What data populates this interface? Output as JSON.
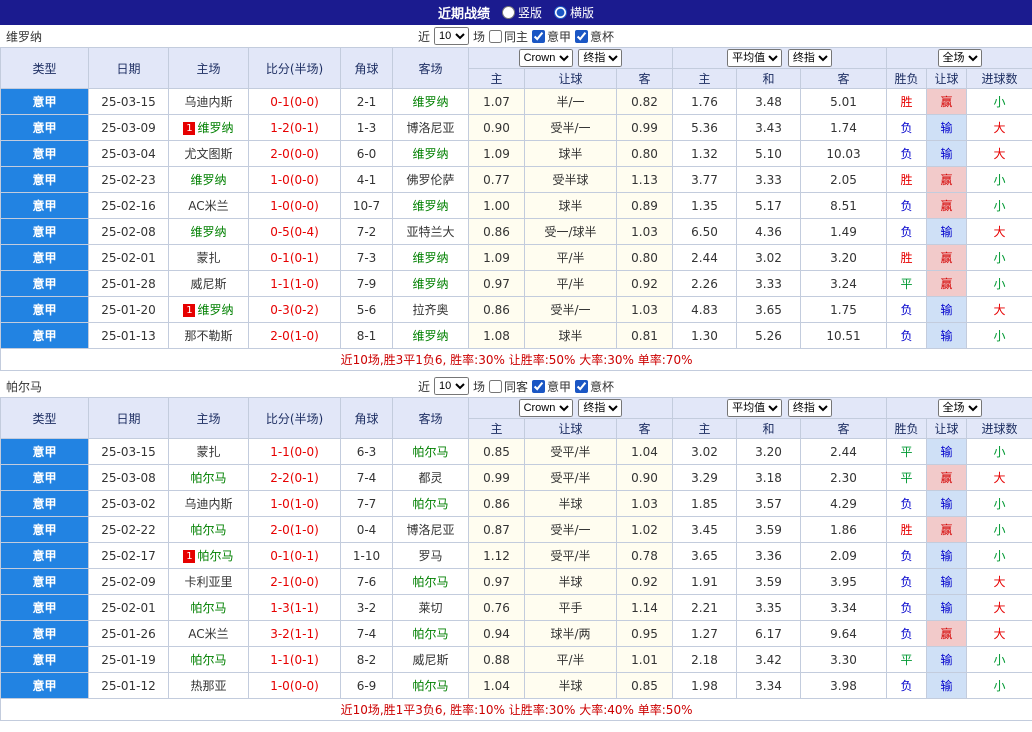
{
  "title_bar": {
    "title": "近期战绩",
    "radios": [
      {
        "label": "竖版",
        "checked": false
      },
      {
        "label": "横版",
        "checked": true
      }
    ]
  },
  "columns": {
    "type": "类型",
    "date": "日期",
    "home": "主场",
    "score": "比分(半场)",
    "corner": "角球",
    "away": "客场",
    "odds_home": "主",
    "odds_handicap": "让球",
    "odds_away": "客",
    "avg_home": "主",
    "avg_draw": "和",
    "avg_away": "客",
    "res_wl": "胜负",
    "res_handicap": "让球",
    "res_goals": "进球数"
  },
  "dropdowns": {
    "source": "Crown",
    "final1": "终指",
    "avg": "平均值",
    "final2": "终指",
    "scope": "全场"
  },
  "colors": {
    "accent_blue": "#2283e2",
    "navy_bar": "#1b1b8f",
    "focus_green": "#008000",
    "win_red": "#e60000",
    "lose_blue": "#0000cc",
    "draw_green": "#009933"
  },
  "tables": [
    {
      "team": "维罗纳",
      "filter": {
        "near": "近",
        "count": "10",
        "unit": "场",
        "checks": [
          {
            "label": "同主",
            "checked": false
          },
          {
            "label": "意甲",
            "checked": true
          },
          {
            "label": "意杯",
            "checked": true
          }
        ]
      },
      "rows": [
        {
          "lg": "意甲",
          "dt": "25-03-15",
          "hcd": "",
          "hm": "乌迪内斯",
          "hf": 0,
          "sc": "0-1(0-0)",
          "cn": "2-1",
          "acd": "",
          "aw": "维罗纳",
          "af": 1,
          "h": "1.07",
          "hd": "半/一",
          "a": "0.82",
          "m1": "1.76",
          "mx": "3.48",
          "m2": "5.01",
          "wl": "胜",
          "wlc": "w",
          "hr": "赢",
          "hrc": "w",
          "gl": "小",
          "glc": "s"
        },
        {
          "lg": "意甲",
          "dt": "25-03-09",
          "hcd": "1",
          "hm": "维罗纳",
          "hf": 1,
          "sc": "1-2(0-1)",
          "cn": "1-3",
          "acd": "",
          "aw": "博洛尼亚",
          "af": 0,
          "h": "0.90",
          "hd": "受半/一",
          "a": "0.99",
          "m1": "5.36",
          "mx": "3.43",
          "m2": "1.74",
          "wl": "负",
          "wlc": "l",
          "hr": "输",
          "hrc": "l",
          "gl": "大",
          "glc": "b"
        },
        {
          "lg": "意甲",
          "dt": "25-03-04",
          "hcd": "",
          "hm": "尤文图斯",
          "hf": 0,
          "sc": "2-0(0-0)",
          "cn": "6-0",
          "acd": "",
          "aw": "维罗纳",
          "af": 1,
          "h": "1.09",
          "hd": "球半",
          "a": "0.80",
          "m1": "1.32",
          "mx": "5.10",
          "m2": "10.03",
          "wl": "负",
          "wlc": "l",
          "hr": "输",
          "hrc": "l",
          "gl": "大",
          "glc": "b"
        },
        {
          "lg": "意甲",
          "dt": "25-02-23",
          "hcd": "",
          "hm": "维罗纳",
          "hf": 1,
          "sc": "1-0(0-0)",
          "cn": "4-1",
          "acd": "",
          "aw": "佛罗伦萨",
          "af": 0,
          "h": "0.77",
          "hd": "受半球",
          "a": "1.13",
          "m1": "3.77",
          "mx": "3.33",
          "m2": "2.05",
          "wl": "胜",
          "wlc": "w",
          "hr": "赢",
          "hrc": "w",
          "gl": "小",
          "glc": "s"
        },
        {
          "lg": "意甲",
          "dt": "25-02-16",
          "hcd": "",
          "hm": "AC米兰",
          "hf": 0,
          "sc": "1-0(0-0)",
          "cn": "10-7",
          "acd": "",
          "aw": "维罗纳",
          "af": 1,
          "h": "1.00",
          "hd": "球半",
          "a": "0.89",
          "m1": "1.35",
          "mx": "5.17",
          "m2": "8.51",
          "wl": "负",
          "wlc": "l",
          "hr": "赢",
          "hrc": "w",
          "gl": "小",
          "glc": "s"
        },
        {
          "lg": "意甲",
          "dt": "25-02-08",
          "hcd": "",
          "hm": "维罗纳",
          "hf": 1,
          "sc": "0-5(0-4)",
          "cn": "7-2",
          "acd": "",
          "aw": "亚特兰大",
          "af": 0,
          "h": "0.86",
          "hd": "受一/球半",
          "a": "1.03",
          "m1": "6.50",
          "mx": "4.36",
          "m2": "1.49",
          "wl": "负",
          "wlc": "l",
          "hr": "输",
          "hrc": "l",
          "gl": "大",
          "glc": "b"
        },
        {
          "lg": "意甲",
          "dt": "25-02-01",
          "hcd": "",
          "hm": "蒙扎",
          "hf": 0,
          "sc": "0-1(0-1)",
          "cn": "7-3",
          "acd": "",
          "aw": "维罗纳",
          "af": 1,
          "h": "1.09",
          "hd": "平/半",
          "a": "0.80",
          "m1": "2.44",
          "mx": "3.02",
          "m2": "3.20",
          "wl": "胜",
          "wlc": "w",
          "hr": "赢",
          "hrc": "w",
          "gl": "小",
          "glc": "s"
        },
        {
          "lg": "意甲",
          "dt": "25-01-28",
          "hcd": "",
          "hm": "威尼斯",
          "hf": 0,
          "sc": "1-1(1-0)",
          "cn": "7-9",
          "acd": "",
          "aw": "维罗纳",
          "af": 1,
          "h": "0.97",
          "hd": "平/半",
          "a": "0.92",
          "m1": "2.26",
          "mx": "3.33",
          "m2": "3.24",
          "wl": "平",
          "wlc": "d",
          "hr": "赢",
          "hrc": "w",
          "gl": "小",
          "glc": "s"
        },
        {
          "lg": "意甲",
          "dt": "25-01-20",
          "hcd": "1",
          "hm": "维罗纳",
          "hf": 1,
          "sc": "0-3(0-2)",
          "cn": "5-6",
          "acd": "",
          "aw": "拉齐奥",
          "af": 0,
          "h": "0.86",
          "hd": "受半/一",
          "a": "1.03",
          "m1": "4.83",
          "mx": "3.65",
          "m2": "1.75",
          "wl": "负",
          "wlc": "l",
          "hr": "输",
          "hrc": "l",
          "gl": "大",
          "glc": "b"
        },
        {
          "lg": "意甲",
          "dt": "25-01-13",
          "hcd": "",
          "hm": "那不勒斯",
          "hf": 0,
          "sc": "2-0(1-0)",
          "cn": "8-1",
          "acd": "",
          "aw": "维罗纳",
          "af": 1,
          "h": "1.08",
          "hd": "球半",
          "a": "0.81",
          "m1": "1.30",
          "mx": "5.26",
          "m2": "10.51",
          "wl": "负",
          "wlc": "l",
          "hr": "输",
          "hrc": "l",
          "gl": "小",
          "glc": "s"
        }
      ],
      "footer": "近10场,胜3平1负6, 胜率:30% 让胜率:50% 大率:30% 单率:70%"
    },
    {
      "team": "帕尔马",
      "filter": {
        "near": "近",
        "count": "10",
        "unit": "场",
        "checks": [
          {
            "label": "同客",
            "checked": false
          },
          {
            "label": "意甲",
            "checked": true
          },
          {
            "label": "意杯",
            "checked": true
          }
        ]
      },
      "rows": [
        {
          "lg": "意甲",
          "dt": "25-03-15",
          "hcd": "",
          "hm": "蒙扎",
          "hf": 0,
          "sc": "1-1(0-0)",
          "cn": "6-3",
          "acd": "",
          "aw": "帕尔马",
          "af": 1,
          "h": "0.85",
          "hd": "受平/半",
          "a": "1.04",
          "m1": "3.02",
          "mx": "3.20",
          "m2": "2.44",
          "wl": "平",
          "wlc": "d",
          "hr": "输",
          "hrc": "l",
          "gl": "小",
          "glc": "s"
        },
        {
          "lg": "意甲",
          "dt": "25-03-08",
          "hcd": "",
          "hm": "帕尔马",
          "hf": 1,
          "sc": "2-2(0-1)",
          "cn": "7-4",
          "acd": "",
          "aw": "都灵",
          "af": 0,
          "h": "0.99",
          "hd": "受平/半",
          "a": "0.90",
          "m1": "3.29",
          "mx": "3.18",
          "m2": "2.30",
          "wl": "平",
          "wlc": "d",
          "hr": "赢",
          "hrc": "w",
          "gl": "大",
          "glc": "b"
        },
        {
          "lg": "意甲",
          "dt": "25-03-02",
          "hcd": "",
          "hm": "乌迪内斯",
          "hf": 0,
          "sc": "1-0(1-0)",
          "cn": "7-7",
          "acd": "",
          "aw": "帕尔马",
          "af": 1,
          "h": "0.86",
          "hd": "半球",
          "a": "1.03",
          "m1": "1.85",
          "mx": "3.57",
          "m2": "4.29",
          "wl": "负",
          "wlc": "l",
          "hr": "输",
          "hrc": "l",
          "gl": "小",
          "glc": "s"
        },
        {
          "lg": "意甲",
          "dt": "25-02-22",
          "hcd": "",
          "hm": "帕尔马",
          "hf": 1,
          "sc": "2-0(1-0)",
          "cn": "0-4",
          "acd": "",
          "aw": "博洛尼亚",
          "af": 0,
          "h": "0.87",
          "hd": "受半/一",
          "a": "1.02",
          "m1": "3.45",
          "mx": "3.59",
          "m2": "1.86",
          "wl": "胜",
          "wlc": "w",
          "hr": "赢",
          "hrc": "w",
          "gl": "小",
          "glc": "s"
        },
        {
          "lg": "意甲",
          "dt": "25-02-17",
          "hcd": "1",
          "hm": "帕尔马",
          "hf": 1,
          "sc": "0-1(0-1)",
          "cn": "1-10",
          "acd": "",
          "aw": "罗马",
          "af": 0,
          "h": "1.12",
          "hd": "受平/半",
          "a": "0.78",
          "m1": "3.65",
          "mx": "3.36",
          "m2": "2.09",
          "wl": "负",
          "wlc": "l",
          "hr": "输",
          "hrc": "l",
          "gl": "小",
          "glc": "s"
        },
        {
          "lg": "意甲",
          "dt": "25-02-09",
          "hcd": "",
          "hm": "卡利亚里",
          "hf": 0,
          "sc": "2-1(0-0)",
          "cn": "7-6",
          "acd": "",
          "aw": "帕尔马",
          "af": 1,
          "h": "0.97",
          "hd": "半球",
          "a": "0.92",
          "m1": "1.91",
          "mx": "3.59",
          "m2": "3.95",
          "wl": "负",
          "wlc": "l",
          "hr": "输",
          "hrc": "l",
          "gl": "大",
          "glc": "b"
        },
        {
          "lg": "意甲",
          "dt": "25-02-01",
          "hcd": "",
          "hm": "帕尔马",
          "hf": 1,
          "sc": "1-3(1-1)",
          "cn": "3-2",
          "acd": "",
          "aw": "莱切",
          "af": 0,
          "h": "0.76",
          "hd": "平手",
          "a": "1.14",
          "m1": "2.21",
          "mx": "3.35",
          "m2": "3.34",
          "wl": "负",
          "wlc": "l",
          "hr": "输",
          "hrc": "l",
          "gl": "大",
          "glc": "b"
        },
        {
          "lg": "意甲",
          "dt": "25-01-26",
          "hcd": "",
          "hm": "AC米兰",
          "hf": 0,
          "sc": "3-2(1-1)",
          "cn": "7-4",
          "acd": "",
          "aw": "帕尔马",
          "af": 1,
          "h": "0.94",
          "hd": "球半/两",
          "a": "0.95",
          "m1": "1.27",
          "mx": "6.17",
          "m2": "9.64",
          "wl": "负",
          "wlc": "l",
          "hr": "赢",
          "hrc": "w",
          "gl": "大",
          "glc": "b"
        },
        {
          "lg": "意甲",
          "dt": "25-01-19",
          "hcd": "",
          "hm": "帕尔马",
          "hf": 1,
          "sc": "1-1(0-1)",
          "cn": "8-2",
          "acd": "",
          "aw": "威尼斯",
          "af": 0,
          "h": "0.88",
          "hd": "平/半",
          "a": "1.01",
          "m1": "2.18",
          "mx": "3.42",
          "m2": "3.30",
          "wl": "平",
          "wlc": "d",
          "hr": "输",
          "hrc": "l",
          "gl": "小",
          "glc": "s"
        },
        {
          "lg": "意甲",
          "dt": "25-01-12",
          "hcd": "",
          "hm": "热那亚",
          "hf": 0,
          "sc": "1-0(0-0)",
          "cn": "6-9",
          "acd": "",
          "aw": "帕尔马",
          "af": 1,
          "h": "1.04",
          "hd": "半球",
          "a": "0.85",
          "m1": "1.98",
          "mx": "3.34",
          "m2": "3.98",
          "wl": "负",
          "wlc": "l",
          "hr": "输",
          "hrc": "l",
          "gl": "小",
          "glc": "s"
        }
      ],
      "footer": "近10场,胜1平3负6, 胜率:10% 让胜率:30% 大率:40% 单率:50%"
    }
  ]
}
